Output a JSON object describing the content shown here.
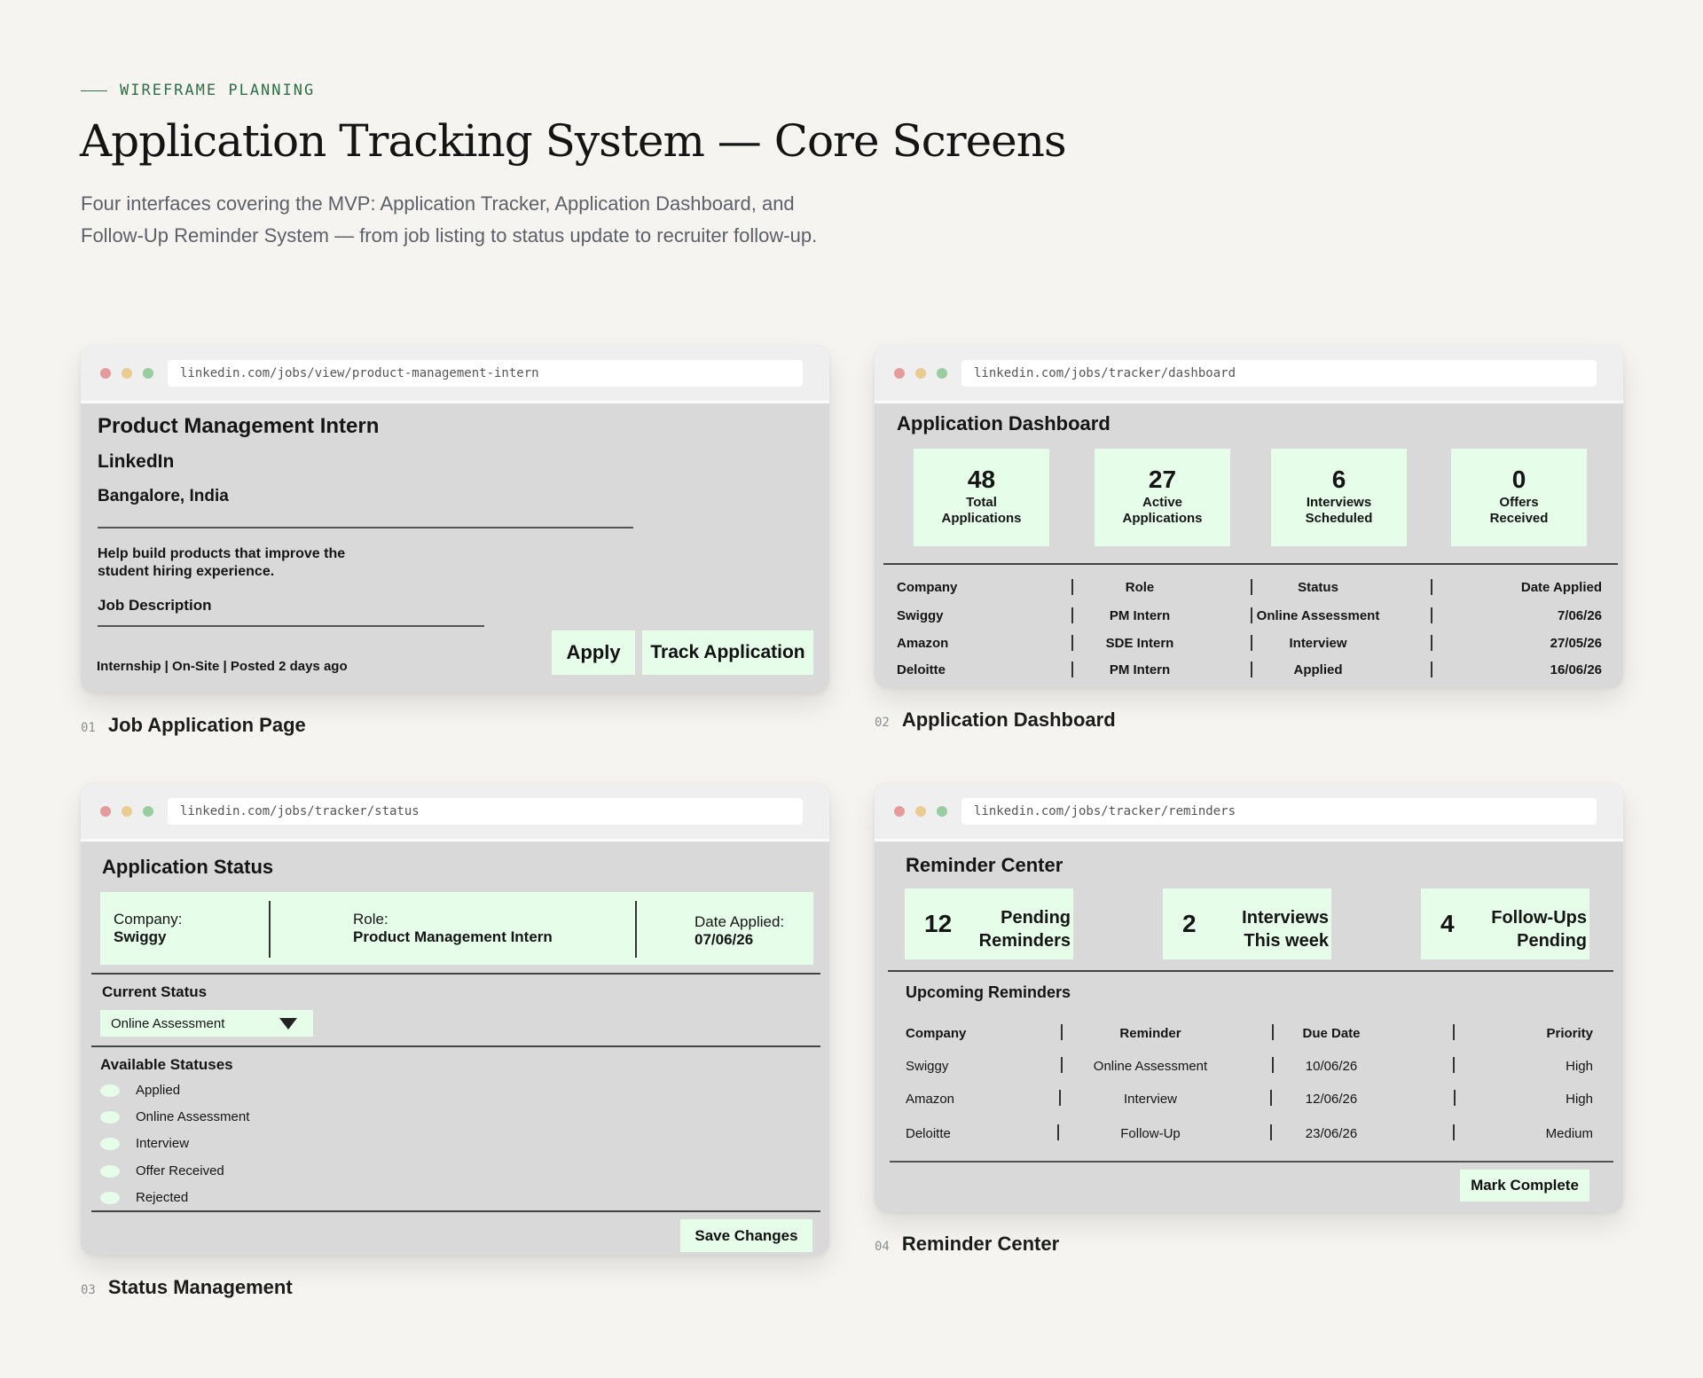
{
  "header": {
    "eyebrow": "WIREFRAME PLANNING",
    "title": "Application Tracking System — Core Screens",
    "subtitle": "Four interfaces covering the MVP: Application Tracker, Application Dashboard, and Follow-Up Reminder System — from job listing to status update to recruiter follow-up."
  },
  "colors": {
    "background": "#f5f4f0",
    "card": "#d9d9d9",
    "mint": "#e6fdea",
    "accent": "#2f6e46"
  },
  "screens": {
    "job": {
      "url": "linkedin.com/jobs/view/product-management-intern",
      "title": "Product Management Intern",
      "company": "LinkedIn",
      "location": "Bangalore, India",
      "description": "Help build products that improve the student hiring experience.",
      "section": "Job Description",
      "meta": "Internship | On-Site | Posted 2 days ago",
      "apply_label": "Apply",
      "track_label": "Track Application",
      "caption_num": "01",
      "caption": "Job Application Page"
    },
    "dashboard": {
      "url": "linkedin.com/jobs/tracker/dashboard",
      "title": "Application Dashboard",
      "stats": [
        {
          "value": "48",
          "label": "Total Applications"
        },
        {
          "value": "27",
          "label": "Active Applications"
        },
        {
          "value": "6",
          "label": "Interviews Scheduled"
        },
        {
          "value": "0",
          "label": "Offers Received"
        }
      ],
      "columns": [
        "Company",
        "Role",
        "Status",
        "Date Applied"
      ],
      "rows": [
        [
          "Swiggy",
          "PM Intern",
          "Online Assessment",
          "7/06/26"
        ],
        [
          "Amazon",
          "SDE Intern",
          "Interview",
          "27/05/26"
        ],
        [
          "Deloitte",
          "PM Intern",
          "Applied",
          "16/06/26"
        ]
      ],
      "caption_num": "02",
      "caption": "Application Dashboard"
    },
    "status": {
      "url": "linkedin.com/jobs/tracker/status",
      "title": "Application Status",
      "company_label": "Company:",
      "company": "Swiggy",
      "role_label": "Role:",
      "role": "Product Management Intern",
      "date_label": "Date Applied:",
      "date": "07/06/26",
      "current_label": "Current Status",
      "current_value": "Online Assessment",
      "available_label": "Available Statuses",
      "options": [
        "Applied",
        "Online Assessment",
        "Interview",
        "Offer Received",
        "Rejected"
      ],
      "save_label": "Save Changes",
      "caption_num": "03",
      "caption": "Status Management"
    },
    "reminders": {
      "url": "linkedin.com/jobs/tracker/reminders",
      "title": "Reminder Center",
      "stats": [
        {
          "value": "12",
          "label_1": "Pending",
          "label_2": "Reminders"
        },
        {
          "value": "2",
          "label_1": "Interviews",
          "label_2": "This week"
        },
        {
          "value": "4",
          "label_1": "Follow-Ups",
          "label_2": "Pending"
        }
      ],
      "subtitle": "Upcoming Reminders",
      "columns": [
        "Company",
        "Reminder",
        "Due Date",
        "Priority"
      ],
      "rows": [
        [
          "Swiggy",
          "Online Assessment",
          "10/06/26",
          "High"
        ],
        [
          "Amazon",
          "Interview",
          "12/06/26",
          "High"
        ],
        [
          "Deloitte",
          "Follow-Up",
          "23/06/26",
          "Medium"
        ]
      ],
      "mark_label": "Mark Complete",
      "caption_num": "04",
      "caption": "Reminder Center"
    }
  }
}
